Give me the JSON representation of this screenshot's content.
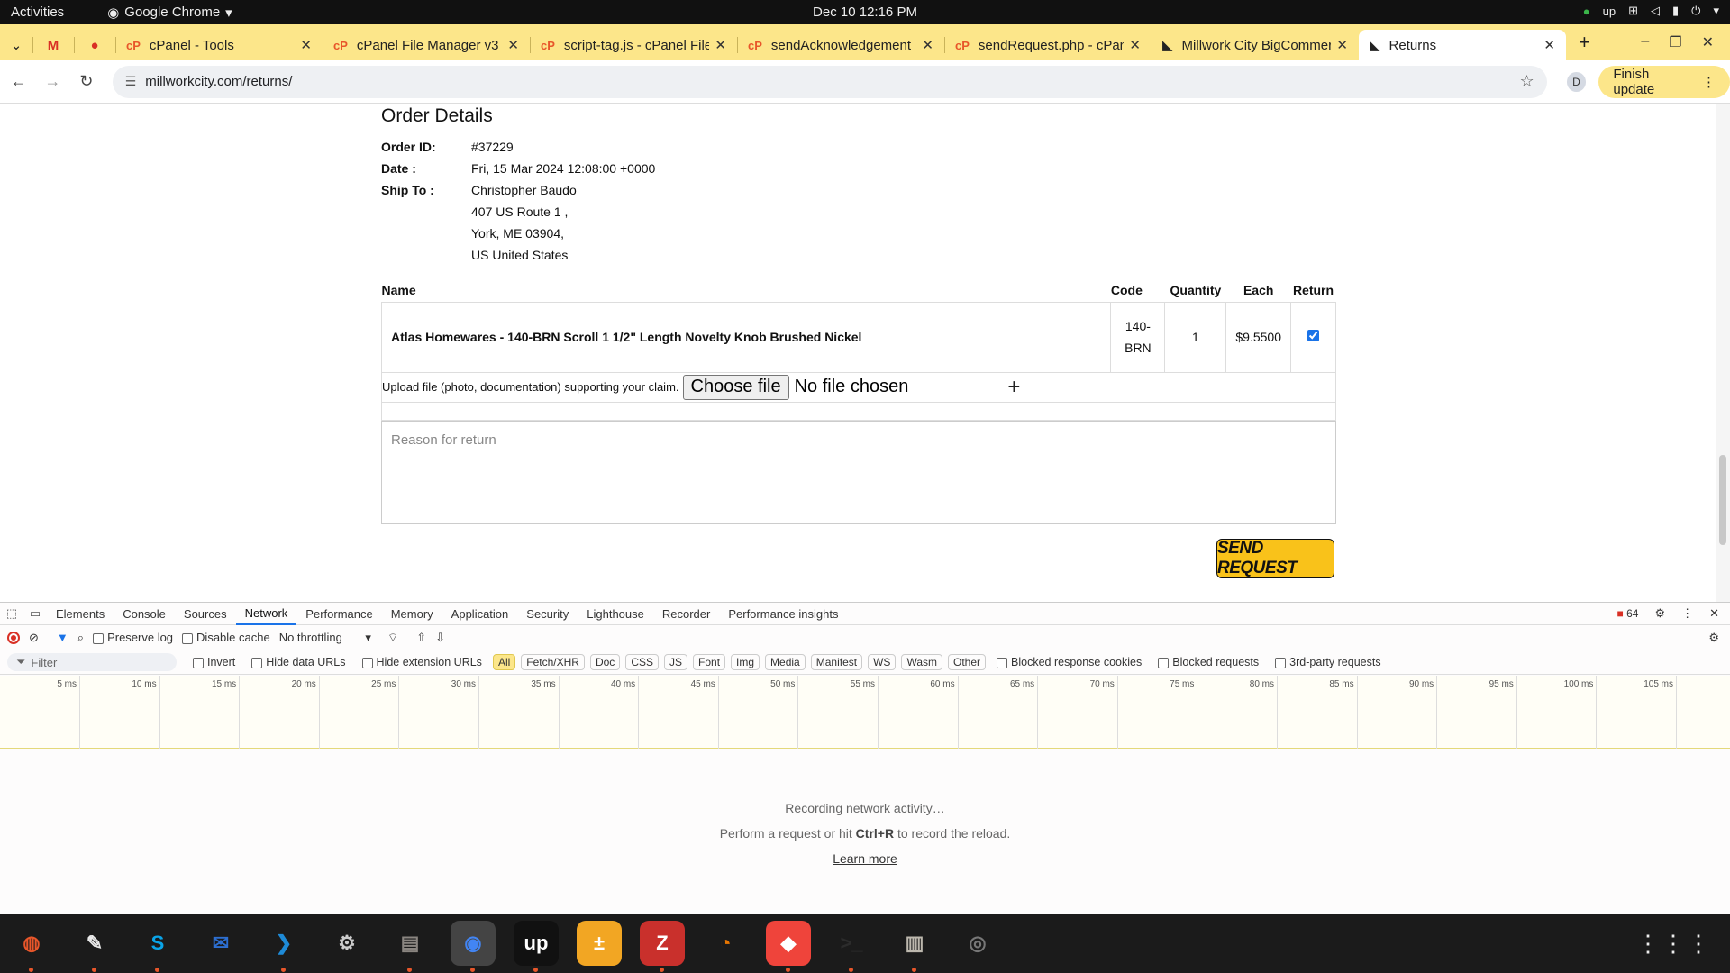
{
  "system": {
    "activities": "Activities",
    "app": "Google Chrome",
    "clock": "Dec 10  12:16 PM"
  },
  "tabs": [
    {
      "label": "",
      "icon": "gmail-icon",
      "pinned": true
    },
    {
      "label": "",
      "icon": "app-icon",
      "pinned": true
    },
    {
      "label": "cPanel - Tools",
      "icon": "cpanel-icon"
    },
    {
      "label": "cPanel File Manager v3",
      "icon": "cpanel-icon"
    },
    {
      "label": "script-tag.js - cPanel File",
      "icon": "cpanel-icon"
    },
    {
      "label": "sendAcknowledgement",
      "icon": "cpanel-icon"
    },
    {
      "label": "sendRequest.php - cPanel",
      "icon": "cpanel-icon"
    },
    {
      "label": "Millwork City BigCommerce",
      "icon": "bigcommerce-icon"
    },
    {
      "label": "Returns",
      "icon": "bigcommerce-icon",
      "active": true
    }
  ],
  "address": {
    "url": "millworkcity.com/returns/",
    "avatar": "D",
    "finish_update": "Finish update"
  },
  "order": {
    "heading": "Order Details",
    "fields": [
      {
        "label": "Order ID:",
        "value": "#37229"
      },
      {
        "label": "Date :",
        "value": "Fri, 15 Mar 2024 12:08:00 +0000"
      },
      {
        "label": "Ship To :",
        "value": "Christopher Baudo"
      },
      {
        "label": "",
        "value": "407 US Route 1 ,"
      },
      {
        "label": "",
        "value": "York, ME 03904,"
      },
      {
        "label": "",
        "value": "US United States"
      }
    ]
  },
  "table": {
    "headers": {
      "name": "Name",
      "code": "Code",
      "qty": "Quantity",
      "each": "Each",
      "ret": "Return"
    },
    "row": {
      "name": "Atlas Homewares - 140-BRN Scroll 1 1/2\" Length Novelty Knob Brushed Nickel",
      "code": "140-BRN",
      "qty": "1",
      "each": "$9.5500",
      "checked": true
    }
  },
  "upload": {
    "label": "Upload file (photo, documentation) supporting your claim.",
    "button": "Choose file",
    "status": "No file chosen"
  },
  "reason": {
    "placeholder": "Reason for return"
  },
  "send_label": "SEND REQUEST",
  "devtools": {
    "tabs": [
      "Elements",
      "Console",
      "Sources",
      "Network",
      "Performance",
      "Memory",
      "Application",
      "Security",
      "Lighthouse",
      "Recorder",
      "Performance insights"
    ],
    "active_tab": "Network",
    "issues": "64",
    "preserve_log": "Preserve log",
    "disable_cache": "Disable cache",
    "throttling": "No throttling",
    "filter_placeholder": "Filter",
    "invert": "Invert",
    "hide_data": "Hide data URLs",
    "hide_ext": "Hide extension URLs",
    "chips": [
      "All",
      "Fetch/XHR",
      "Doc",
      "CSS",
      "JS",
      "Font",
      "Img",
      "Media",
      "Manifest",
      "WS",
      "Wasm",
      "Other"
    ],
    "blocked_cookies": "Blocked response cookies",
    "blocked_req": "Blocked requests",
    "third_party": "3rd-party requests",
    "ticks": [
      "5 ms",
      "10 ms",
      "15 ms",
      "20 ms",
      "25 ms",
      "30 ms",
      "35 ms",
      "40 ms",
      "45 ms",
      "50 ms",
      "55 ms",
      "60 ms",
      "65 ms",
      "70 ms",
      "75 ms",
      "80 ms",
      "85 ms",
      "90 ms",
      "95 ms",
      "100 ms",
      "105 ms"
    ],
    "empty1": "Recording network activity…",
    "empty2a": "Perform a request or hit ",
    "empty2b": "Ctrl+R",
    "empty2c": " to record the reload.",
    "learn": "Learn more"
  },
  "dock": [
    "firefox-icon",
    "text-editor-icon",
    "skype-icon",
    "thunderbird-icon",
    "vscode-icon",
    "settings-icon",
    "files-icon",
    "chrome-icon",
    "upwork-icon",
    "calculator-icon",
    "filezilla-icon",
    "blender-icon",
    "anydesk-icon",
    "terminal-icon",
    "archive-icon",
    "disk-icon"
  ]
}
